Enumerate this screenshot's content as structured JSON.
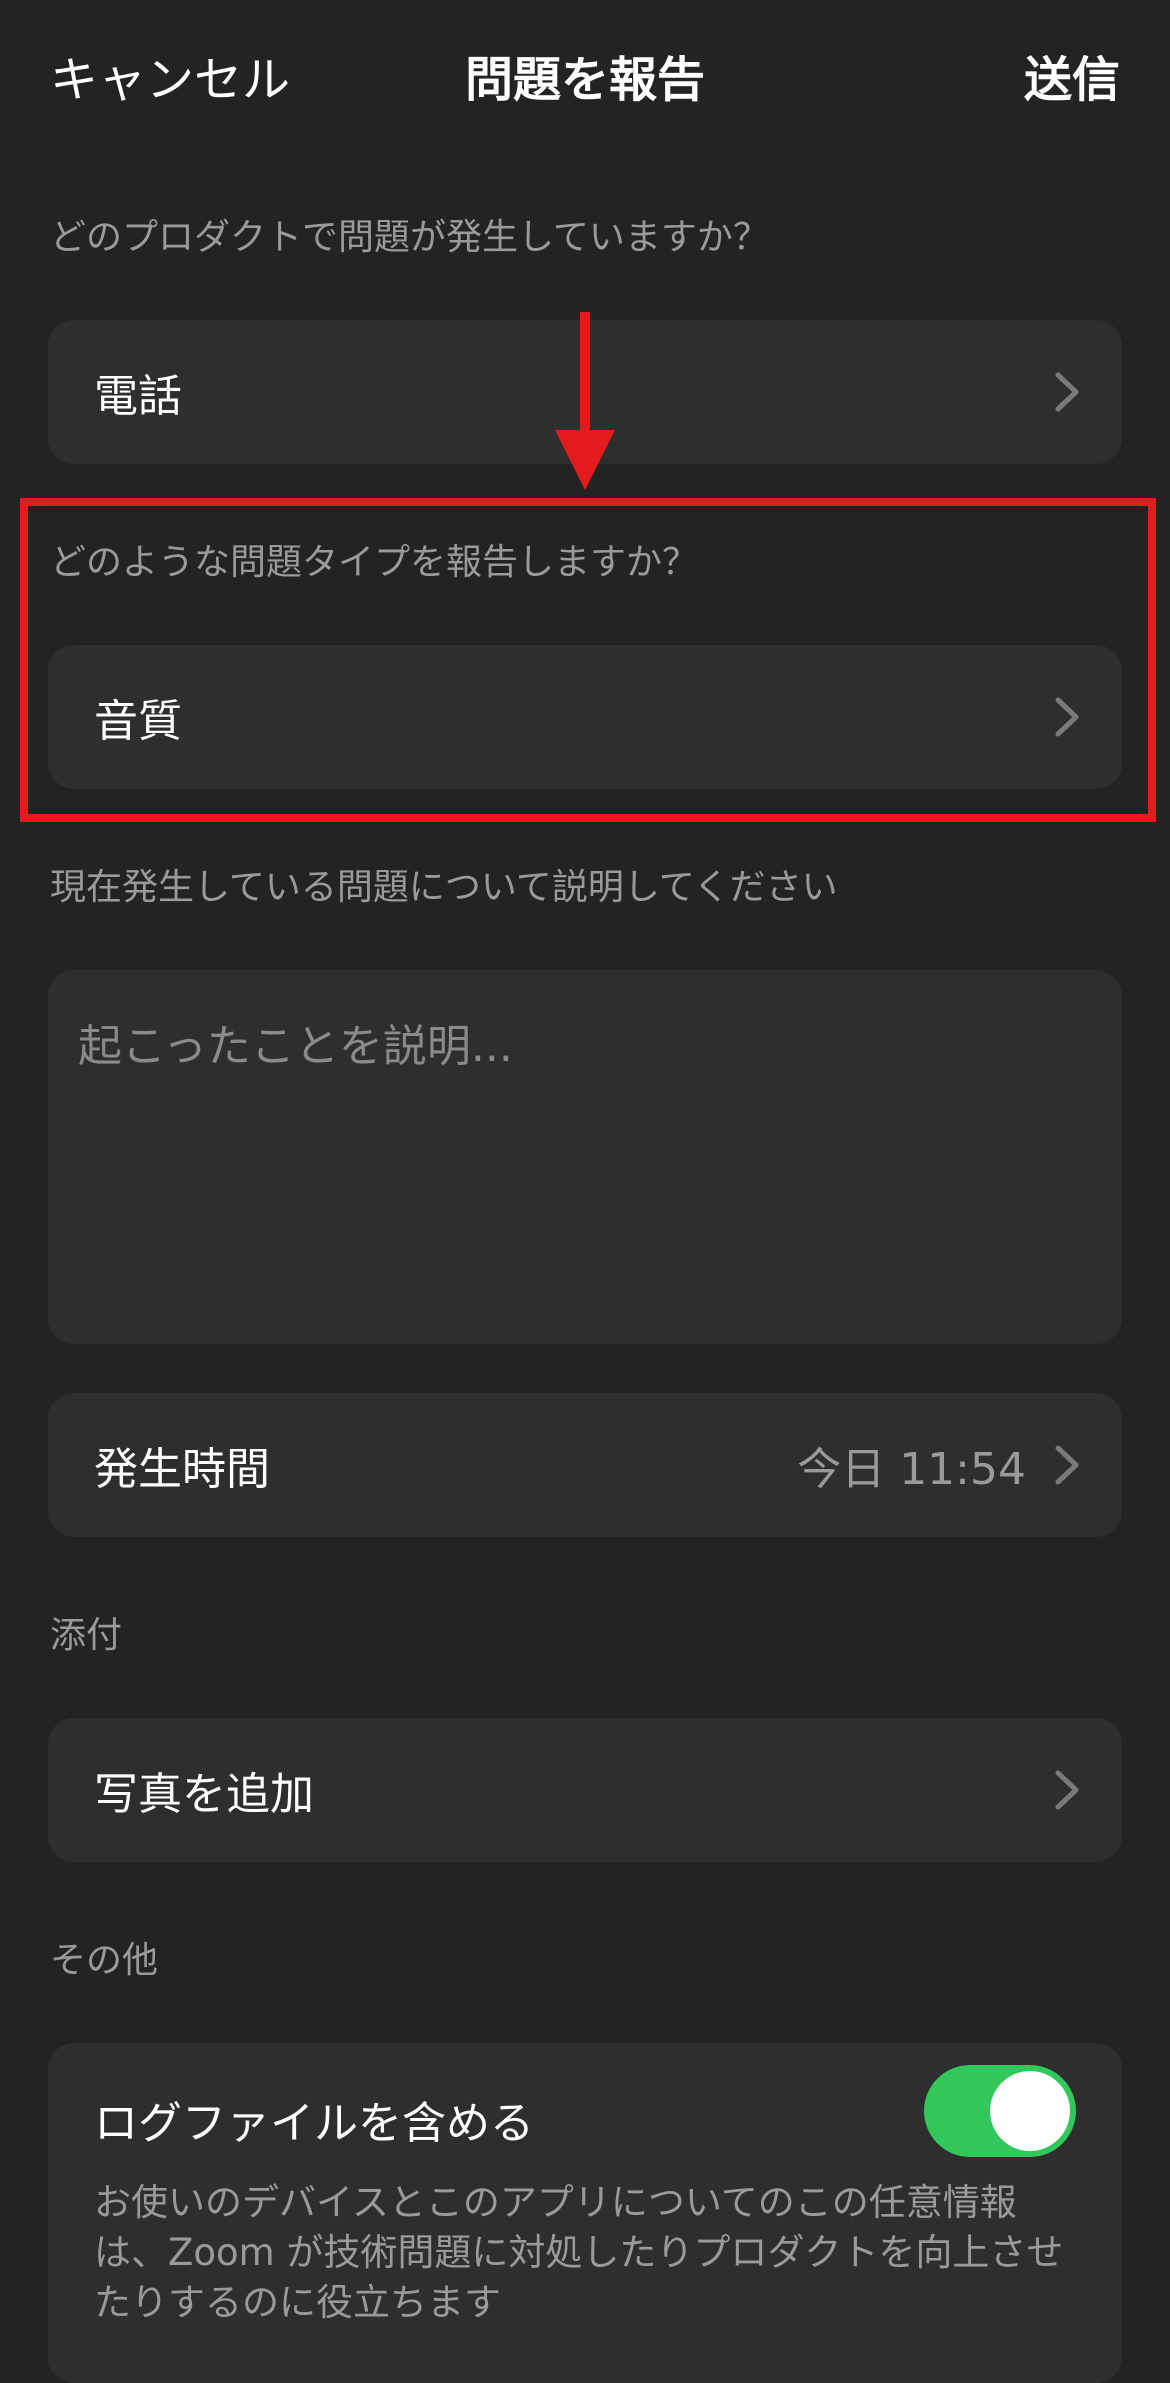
{
  "header": {
    "cancel": "キャンセル",
    "title": "問題を報告",
    "send": "送信"
  },
  "product": {
    "question": "どのプロダクトで問題が発生していますか？",
    "value": "電話"
  },
  "issue_type": {
    "question": "どのような問題タイプを報告しますか？",
    "value": "音質"
  },
  "description": {
    "question": "現在発生している問題について説明してください",
    "placeholder": "起こったことを説明..."
  },
  "occurrence": {
    "label": "発生時間",
    "value": "今日 11:54"
  },
  "attachments": {
    "section": "添付",
    "add_photo": "写真を追加"
  },
  "other": {
    "section": "その他",
    "include_logs": "ログファイルを含める",
    "include_logs_on": true,
    "note": "お使いのデバイスとこのアプリについてのこの任意情報は、Zoom が技術問題に対処したりプロダクトを向上させたりするのに役立ちます"
  },
  "colors": {
    "background": "#232323",
    "row": "#2e2e2e",
    "toggle_on": "#31c75a",
    "annotation": "#e21c1c"
  }
}
